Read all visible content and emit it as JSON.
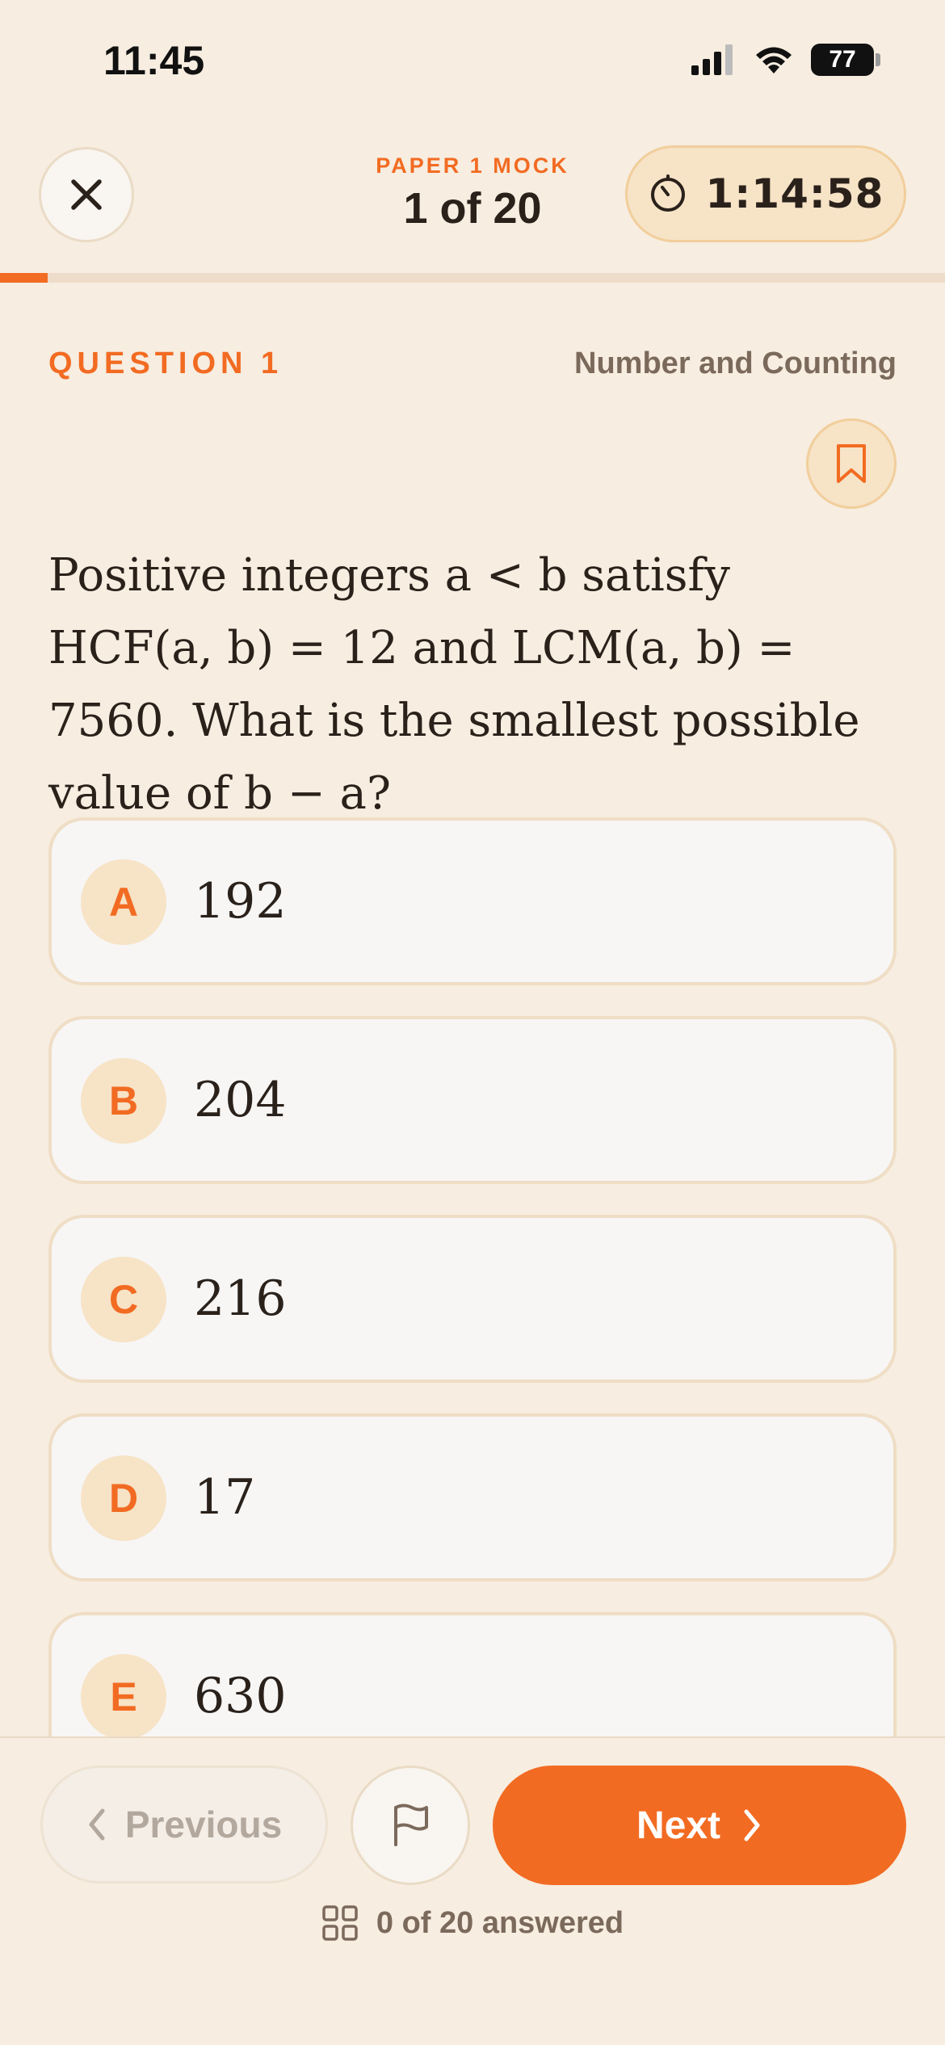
{
  "status_bar": {
    "time": "11:45",
    "battery": "77"
  },
  "header": {
    "paper_label": "PAPER 1 MOCK",
    "progress_label": "1 of 20",
    "timer": "1:14:58",
    "progress_fraction": 0.05
  },
  "question": {
    "number_label": "QUESTION 1",
    "topic": "Number and Counting",
    "text": "Positive integers a < b satisfy HCF(a, b) = 12 and LCM(a, b) = 7560.  What is the smallest possible value of b − a?"
  },
  "options": [
    {
      "letter": "A",
      "value": "192"
    },
    {
      "letter": "B",
      "value": "204"
    },
    {
      "letter": "C",
      "value": "216"
    },
    {
      "letter": "D",
      "value": "17"
    },
    {
      "letter": "E",
      "value": "630"
    }
  ],
  "footer": {
    "previous_label": "Previous",
    "next_label": "Next",
    "answered_text": "0 of 20 answered"
  },
  "colors": {
    "accent": "#F26B22",
    "background": "#F7EDE0"
  }
}
